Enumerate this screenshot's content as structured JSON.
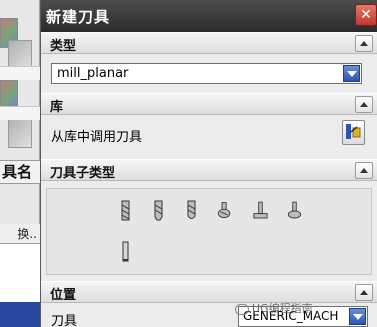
{
  "background_app": {
    "column_header": "具名",
    "sub_header": "换.."
  },
  "dialog": {
    "title": "新建刀具",
    "close_glyph": "✕",
    "sections": {
      "type": {
        "header": "类型",
        "select_value": "mill_planar"
      },
      "library": {
        "header": "库",
        "row_label": "从库中调用刀具"
      },
      "subtype": {
        "header": "刀具子类型",
        "icons": [
          "end-mill-tool-icon",
          "chamfer-mill-tool-icon",
          "ball-mill-tool-icon",
          "face-mill-tool-icon",
          "t-cutter-tool-icon",
          "barrel-cutter-tool-icon",
          "thread-mill-tool-icon"
        ]
      },
      "position": {
        "header": "位置",
        "tool_label": "刀具",
        "tool_value": "GENERIC_MACH"
      }
    }
  },
  "watermark": {
    "text": "UG编程指南"
  },
  "colors": {
    "titlebar": "#3a3a3a",
    "accent_dropdown": "#2b56b5",
    "close": "#c0392b"
  }
}
